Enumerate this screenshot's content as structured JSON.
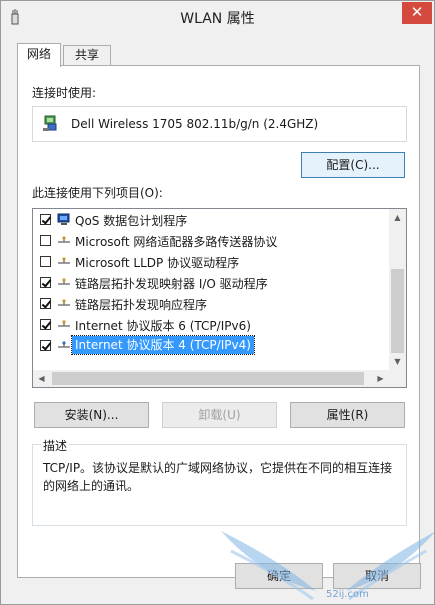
{
  "window": {
    "title": "WLAN 属性",
    "close_glyph": "✕"
  },
  "tabs": [
    {
      "label": "网络"
    },
    {
      "label": "共享"
    }
  ],
  "connect_using": {
    "label": "连接时使用:",
    "adapter": "Dell Wireless 1705 802.11b/g/n (2.4GHZ)"
  },
  "configure_button": "配置(C)...",
  "items_label": "此连接使用下列项目(O):",
  "items": [
    {
      "label": "QoS 数据包计划程序",
      "checked": true,
      "selected": false,
      "icon": "qos-icon"
    },
    {
      "label": "Microsoft 网络适配器多路传送器协议",
      "checked": false,
      "selected": false,
      "icon": "protocol-icon"
    },
    {
      "label": "Microsoft LLDP 协议驱动程序",
      "checked": false,
      "selected": false,
      "icon": "protocol-icon"
    },
    {
      "label": "链路层拓扑发现映射器 I/O 驱动程序",
      "checked": true,
      "selected": false,
      "icon": "protocol-icon"
    },
    {
      "label": "链路层拓扑发现响应程序",
      "checked": true,
      "selected": false,
      "icon": "protocol-icon"
    },
    {
      "label": "Internet 协议版本 6 (TCP/IPv6)",
      "checked": true,
      "selected": false,
      "icon": "protocol-icon"
    },
    {
      "label": "Internet 协议版本 4 (TCP/IPv4)",
      "checked": true,
      "selected": true,
      "icon": "protocol-icon"
    }
  ],
  "buttons": {
    "install": "安装(N)...",
    "uninstall": "卸载(U)",
    "properties": "属性(R)"
  },
  "description": {
    "legend": "描述",
    "text": "TCP/IP。该协议是默认的广域网络协议，它提供在不同的相互连接的网络上的通讯。"
  },
  "footer": {
    "ok": "确定",
    "cancel": "取消"
  },
  "watermark": {
    "site": "52ij.com"
  },
  "colors": {
    "selection": "#3399ff",
    "close": "#d54a3e"
  }
}
